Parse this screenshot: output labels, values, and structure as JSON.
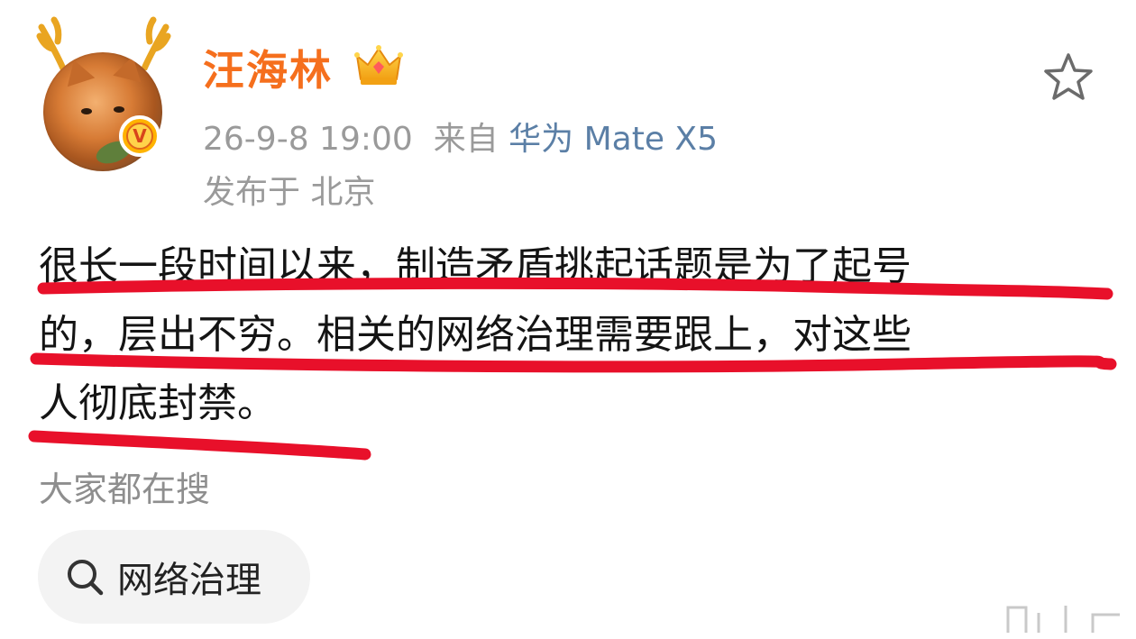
{
  "post": {
    "username": "汪海林",
    "meta_time": "26-9-8 19:00",
    "meta_from": "来自",
    "meta_device": "华为 Mate X5",
    "location": "发布于 北京",
    "body_lines": [
      "很长一段时间以来，制造矛盾挑起话题是为了起号",
      "的，层出不穷。相关的网络治理需要跟上，对这些",
      "人彻底封禁。"
    ]
  },
  "trending": {
    "label": "大家都在搜",
    "chip_label": "网络治理"
  },
  "icons": {
    "avatar": "cat-avatar-with-antlers",
    "verified": "orange-v-badge",
    "crown": "crown-icon",
    "favorite": "star-outline-icon",
    "search": "search-icon"
  },
  "colors": {
    "username": "#f56f1d",
    "device": "#5b7fa6",
    "meta": "#9a9a9a",
    "annotation": "#e8102a",
    "chip_bg": "#f3f3f3"
  }
}
